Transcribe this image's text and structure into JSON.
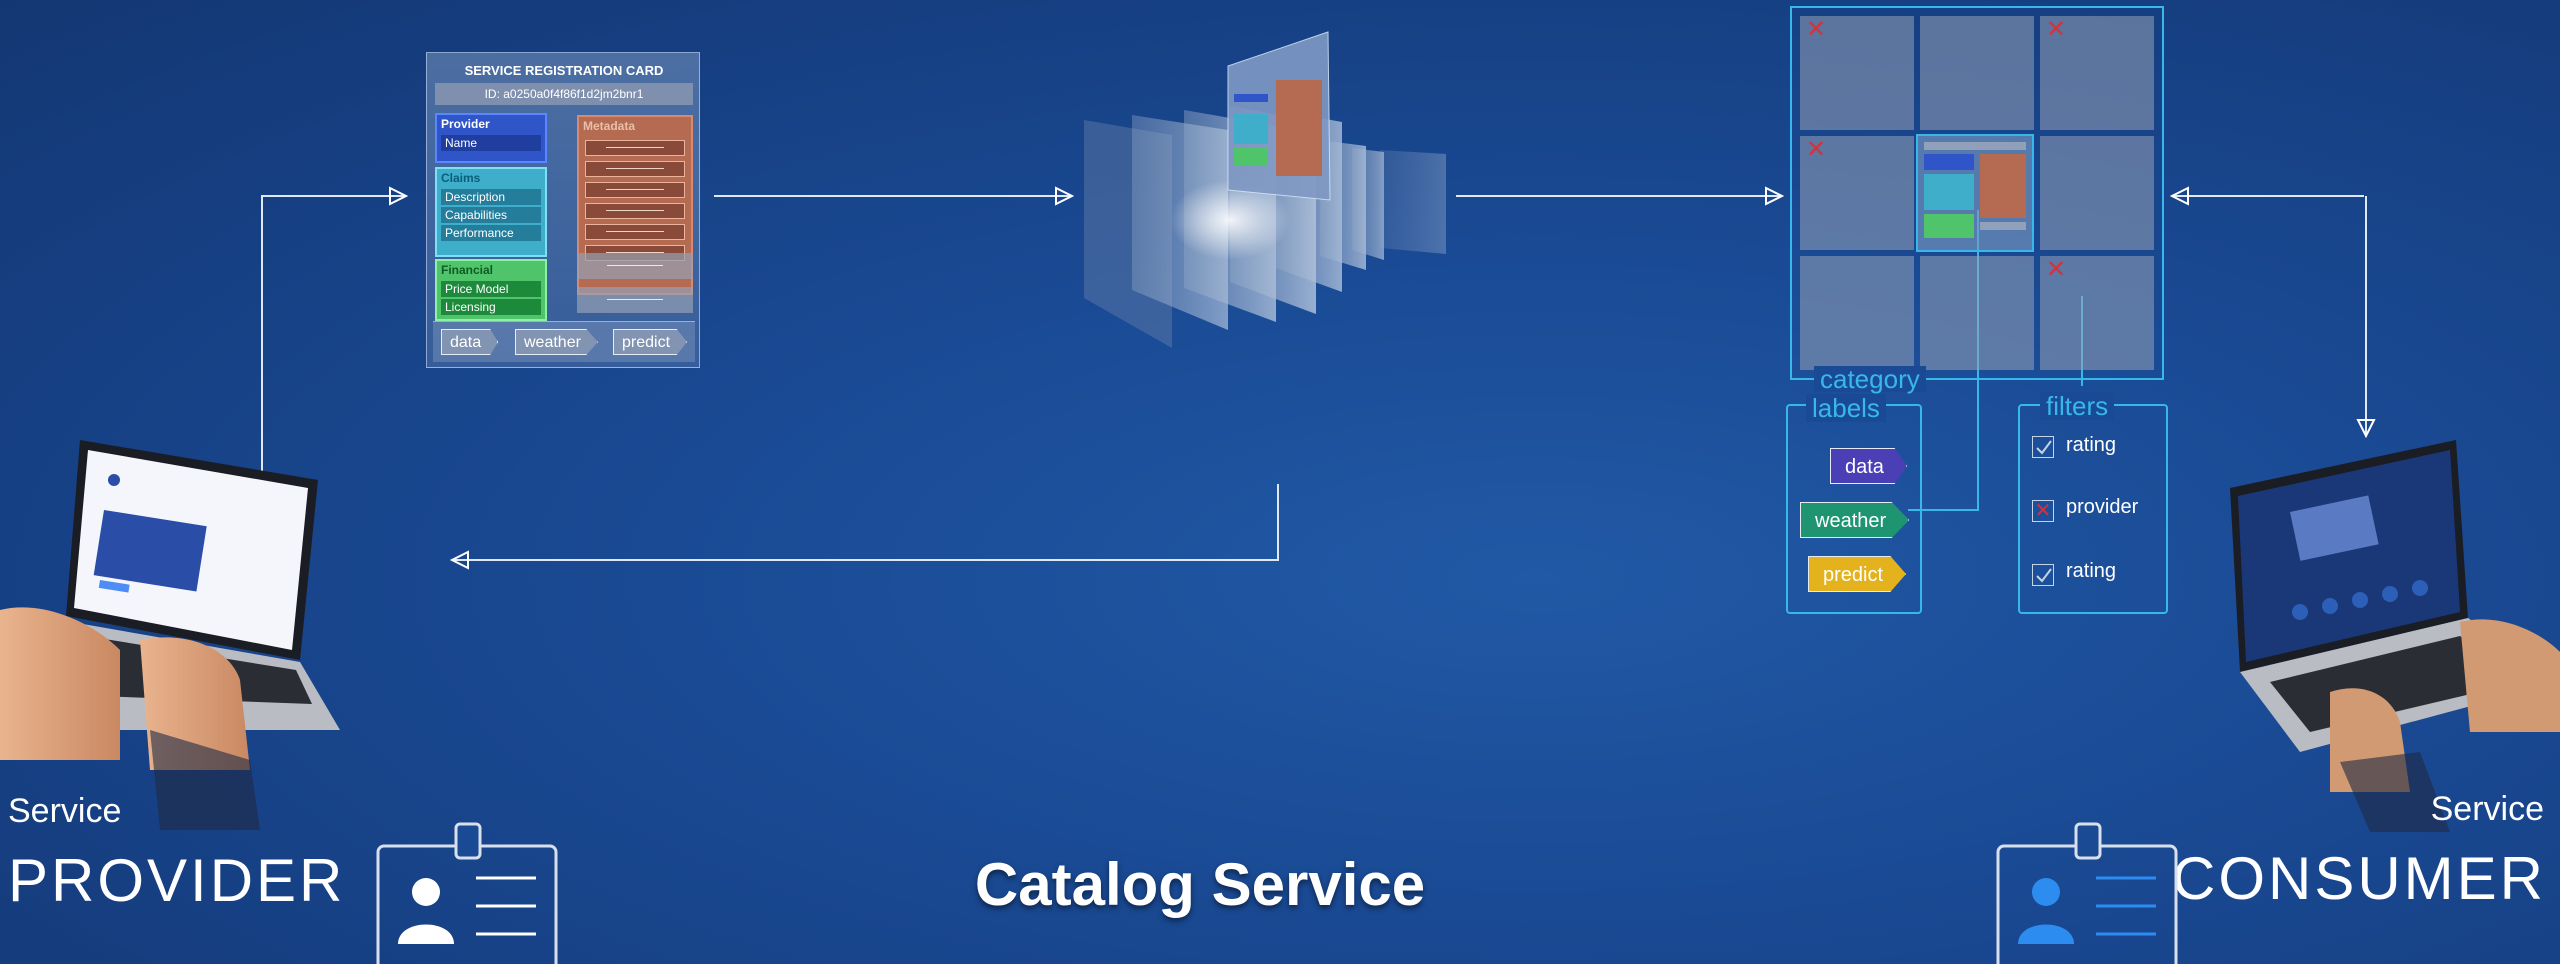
{
  "registration_card": {
    "title": "SERVICE REGISTRATION CARD",
    "id": "ID: a0250a0f4f86f1d2jm2bnr1",
    "provider": {
      "label": "Provider",
      "fields": [
        "Name"
      ]
    },
    "claims": {
      "label": "Claims",
      "fields": [
        "Description",
        "Capabilities",
        "Performance"
      ]
    },
    "financial": {
      "label": "Financial",
      "fields": [
        "Price Model",
        "Licensing"
      ]
    },
    "metadata_label": "Metadata",
    "tags": [
      "data",
      "weather",
      "predict"
    ]
  },
  "grid": {
    "panel_title": "category"
  },
  "labels_panel": {
    "title": "labels",
    "items": [
      {
        "text": "data",
        "color": "#4a3fb5"
      },
      {
        "text": "weather",
        "color": "#1f9470"
      },
      {
        "text": "predict",
        "color": "#e3b21c"
      }
    ]
  },
  "filters_panel": {
    "title": "filters",
    "items": [
      {
        "text": "rating",
        "state": "checked"
      },
      {
        "text": "provider",
        "state": "crossed"
      },
      {
        "text": "rating",
        "state": "checked"
      }
    ]
  },
  "provider": {
    "small": "Service",
    "big": "PROVIDER"
  },
  "consumer": {
    "small": "Service",
    "big": "CONSUMER"
  },
  "center_title": "Catalog Service",
  "colors": {
    "accent": "#38b8ea",
    "background": "#1a4a94",
    "cross": "#d9303a",
    "consumer_badge": "#2d8cf0"
  }
}
